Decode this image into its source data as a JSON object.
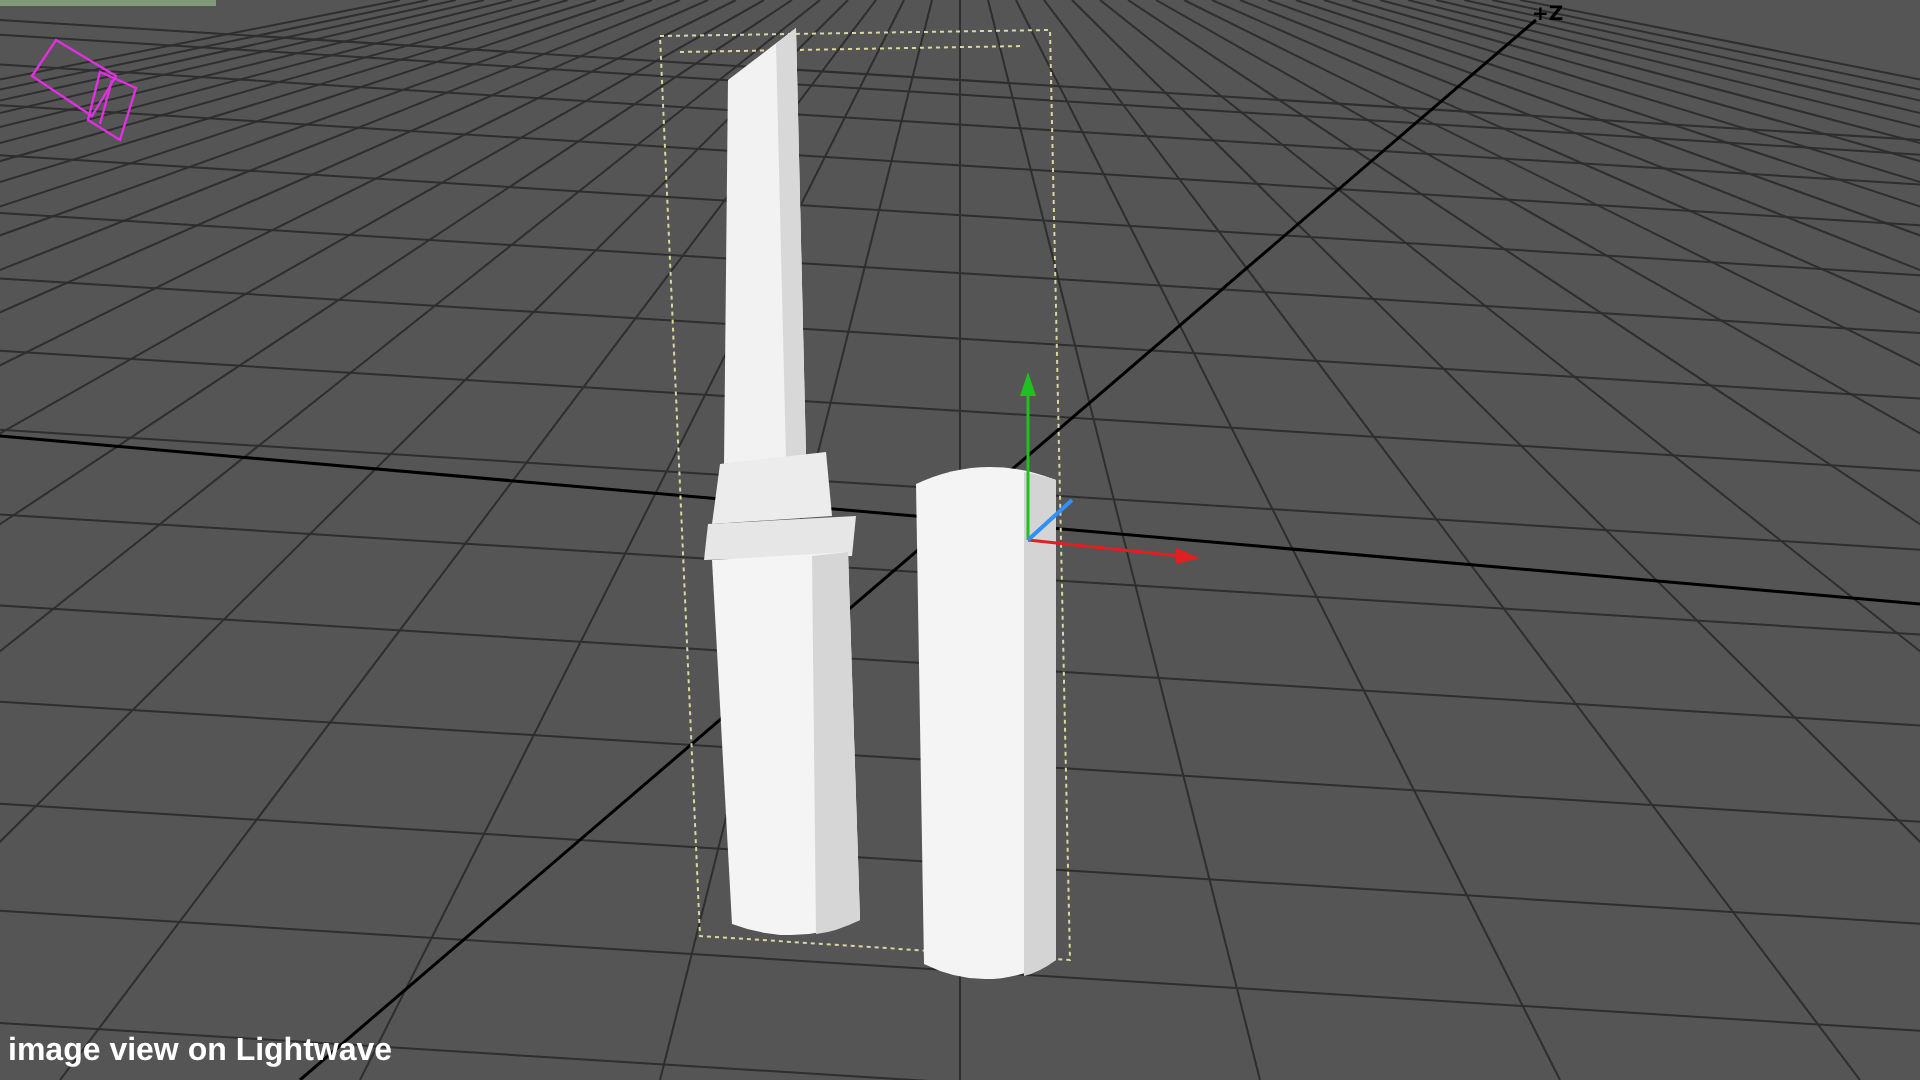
{
  "viewport": {
    "axis_label": "+Z"
  },
  "caption": "image view on Lightwave"
}
